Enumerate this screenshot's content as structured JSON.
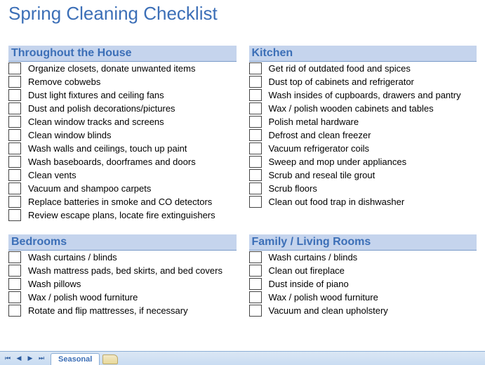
{
  "title": "Spring Cleaning Checklist",
  "sections": {
    "house": {
      "title": "Throughout the House",
      "items": [
        "Organize closets, donate unwanted items",
        "Remove cobwebs",
        "Dust light fixtures and ceiling fans",
        "Dust and polish decorations/pictures",
        "Clean window tracks and screens",
        "Clean window blinds",
        "Wash walls and ceilings, touch up paint",
        "Wash baseboards, doorframes and doors",
        "Clean vents",
        "Vacuum and shampoo carpets",
        "Replace batteries in smoke and CO detectors",
        "Review escape plans, locate fire extinguishers"
      ]
    },
    "kitchen": {
      "title": "Kitchen",
      "items": [
        "Get rid of outdated food and spices",
        "Dust top of cabinets and refrigerator",
        "Wash insides of cupboards, drawers and pantry",
        "Wax / polish wooden cabinets and tables",
        "Polish metal hardware",
        "Defrost and clean freezer",
        "Vacuum refrigerator coils",
        "Sweep and mop under appliances",
        "Scrub and reseal tile grout",
        "Scrub floors",
        "Clean out food trap in dishwasher"
      ]
    },
    "bedrooms": {
      "title": "Bedrooms",
      "items": [
        "Wash curtains / blinds",
        "Wash mattress pads, bed skirts, and bed covers",
        "Wash pillows",
        "Wax / polish wood furniture",
        "Rotate and flip mattresses, if necessary"
      ]
    },
    "family": {
      "title": "Family / Living Rooms",
      "items": [
        "Wash curtains / blinds",
        "Clean out fireplace",
        "Dust inside of piano",
        "Wax / polish wood furniture",
        "Vacuum and clean upholstery"
      ]
    }
  },
  "tab": "Seasonal"
}
